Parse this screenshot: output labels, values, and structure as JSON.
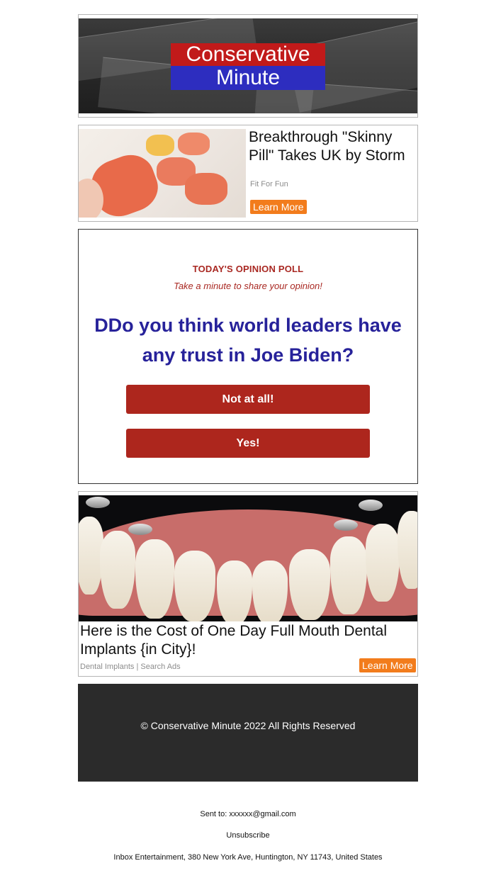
{
  "header": {
    "logo_top": "Conservative",
    "logo_bottom": "Minute"
  },
  "ad1": {
    "title": "Breakthrough \"Skinny Pill\" Takes UK by Storm",
    "source": "Fit For Fun",
    "cta": "Learn More"
  },
  "poll": {
    "kicker": "TODAY'S OPINION POLL",
    "subtitle": "Take a minute to share your opinion!",
    "question": "DDo you think world leaders have any trust in Joe Biden?",
    "option_1": "Not at all!",
    "option_2": "Yes!"
  },
  "ad2": {
    "title": "Here is the Cost of One Day Full Mouth Dental Implants {in City}!",
    "source": "Dental Implants | Search Ads",
    "cta": "Learn More"
  },
  "footer": {
    "copyright": "© Conservative Minute 2022 All Rights Reserved"
  },
  "meta": {
    "sent_to": "Sent to: xxxxxx@gmail.com",
    "unsubscribe": "Unsubscribe",
    "address": "Inbox Entertainment, 380 New York Ave, Huntington, NY 11743, United States"
  },
  "colors": {
    "poll_red": "#ad261d",
    "poll_blue": "#27229a",
    "cta_orange": "#f27c1c",
    "logo_red": "#c11a1a",
    "logo_blue": "#2d2dbf"
  }
}
